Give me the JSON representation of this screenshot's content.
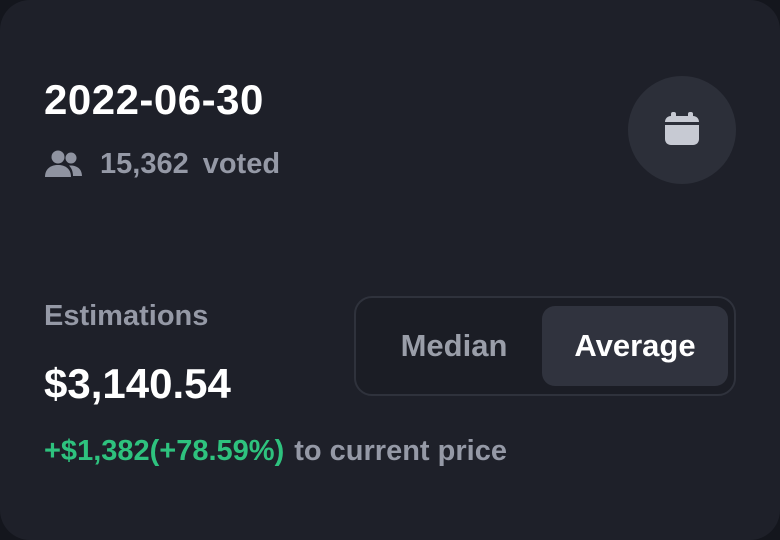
{
  "header": {
    "date": "2022-06-30",
    "voted_count": "15,362",
    "voted_suffix": "voted"
  },
  "icons": {
    "users": "users-icon",
    "calendar": "calendar-icon"
  },
  "estimations": {
    "label": "Estimations",
    "value": "$3,140.54",
    "change": "+$1,382(+78.59%)",
    "change_suffix": "to current price"
  },
  "toggle": {
    "options": [
      "Median",
      "Average"
    ],
    "selected": "Average"
  },
  "colors": {
    "card_background": "#1e2029",
    "positive": "#2ec27e",
    "muted_text": "#9599a6",
    "selected_option_bg": "#30333e"
  }
}
